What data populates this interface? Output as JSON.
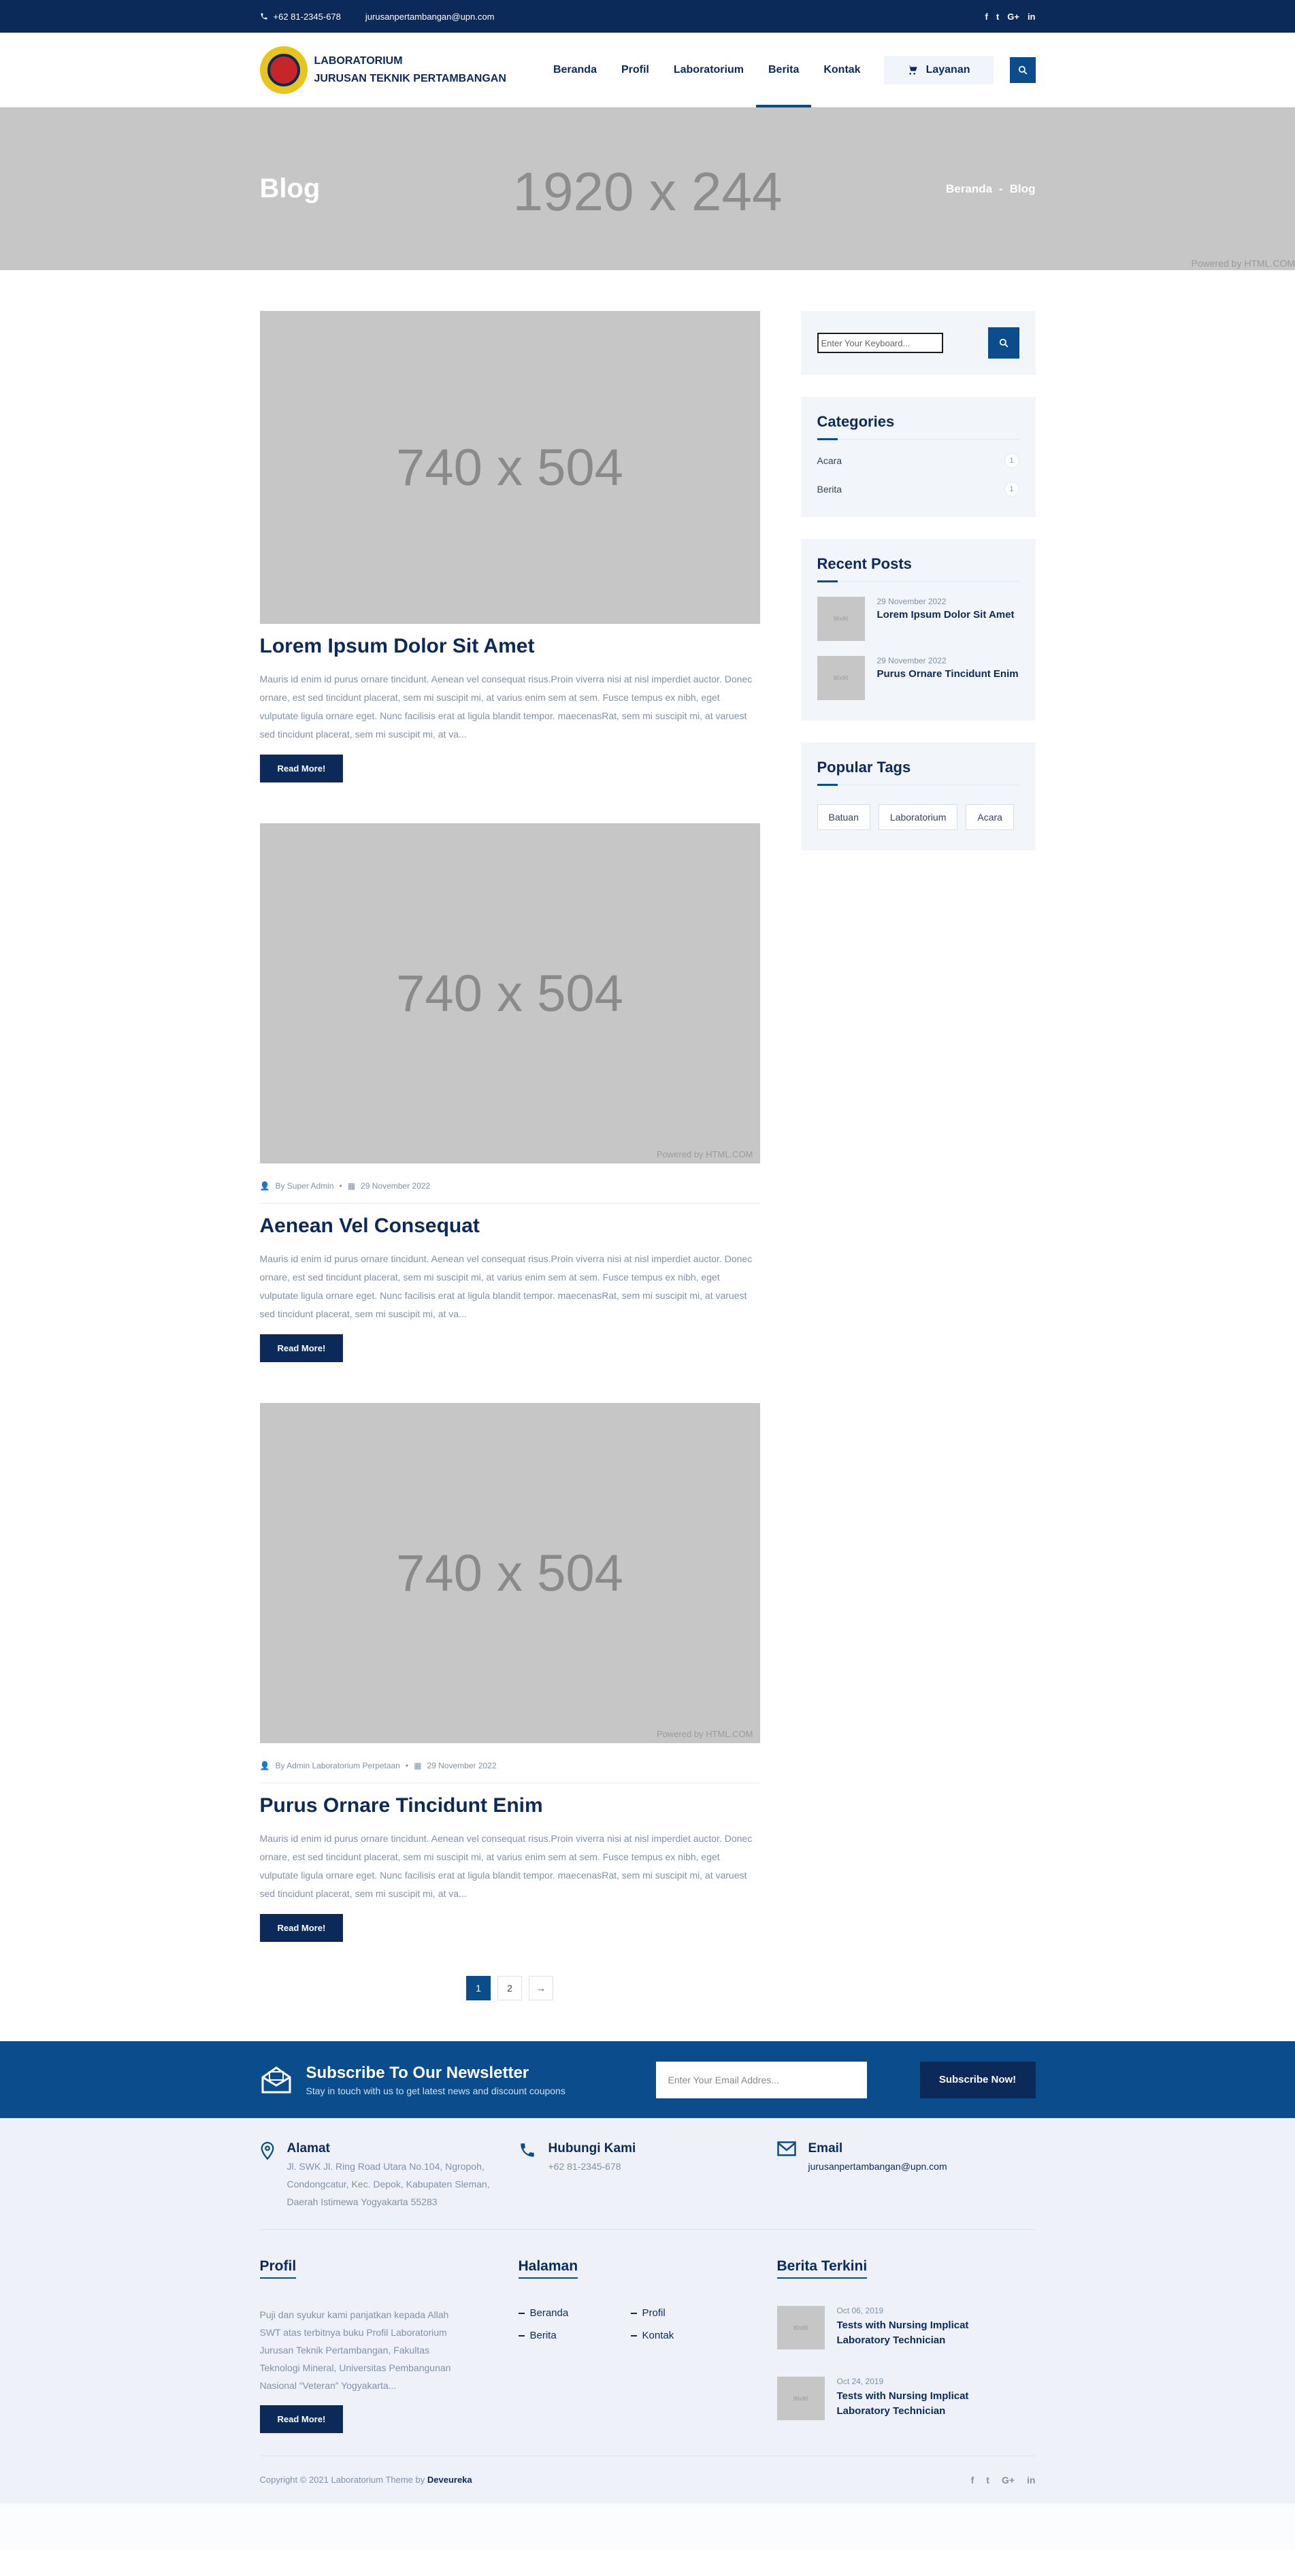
{
  "topbar": {
    "phone": "+62 81-2345-678",
    "email": "jurusanpertambangan@upn.com",
    "social": [
      "f",
      "t",
      "G+",
      "in"
    ]
  },
  "header": {
    "brand_line1": "LABORATORIUM",
    "brand_line2": "JURUSAN TEKNIK PERTAMBANGAN",
    "nav": [
      "Beranda",
      "Profil",
      "Laboratorium",
      "Berita",
      "Kontak"
    ],
    "layanan": "Layanan"
  },
  "hero": {
    "title": "Blog",
    "placeholder": "1920 x 244",
    "crumb_home": "Beranda",
    "crumb_sep": "-",
    "crumb_current": "Blog",
    "powered": "Powered by HTML.COM"
  },
  "posts": [
    {
      "image": "740 x 504",
      "powered": "",
      "author": "",
      "date": "",
      "title": "Lorem Ipsum Dolor Sit Amet",
      "excerpt": "Mauris id enim id purus ornare tincidunt. Aenean vel consequat risus.Proin viverra nisi at nisl imperdiet auctor. Donec ornare, est sed tincidunt placerat, sem mi suscipit mi, at varius enim sem at sem. Fusce tempus ex nibh, eget vulputate ligula ornare eget. Nunc facilisis erat at ligula blandit tempor. maecenasRat, sem mi suscipit mi, at varuest sed tincidunt placerat, sem mi suscipit mi, at va...",
      "button": "Read More!"
    },
    {
      "image": "740 x 504",
      "powered": "Powered by HTML.COM",
      "author": "By Super Admin",
      "date": "29 November 2022",
      "title": "Aenean Vel Consequat",
      "excerpt": "Mauris id enim id purus ornare tincidunt. Aenean vel consequat risus.Proin viverra nisi at nisl imperdiet auctor. Donec ornare, est sed tincidunt placerat, sem mi suscipit mi, at varius enim sem at sem. Fusce tempus ex nibh, eget vulputate ligula ornare eget. Nunc facilisis erat at ligula blandit tempor. maecenasRat, sem mi suscipit mi, at varuest sed tincidunt placerat, sem mi suscipit mi, at va...",
      "button": "Read More!"
    },
    {
      "image": "740 x 504",
      "powered": "Powered by HTML.COM",
      "author": "By Admin Laboratorium Perpetaan",
      "date": "29 November 2022",
      "title": "Purus Ornare Tincidunt Enim",
      "excerpt": "Mauris id enim id purus ornare tincidunt. Aenean vel consequat risus.Proin viverra nisi at nisl imperdiet auctor. Donec ornare, est sed tincidunt placerat, sem mi suscipit mi, at varius enim sem at sem. Fusce tempus ex nibh, eget vulputate ligula ornare eget. Nunc facilisis erat at ligula blandit tempor. maecenasRat, sem mi suscipit mi, at varuest sed tincidunt placerat, sem mi suscipit mi, at va...",
      "button": "Read More!"
    }
  ],
  "pagination": [
    "1",
    "2",
    "→"
  ],
  "sidebar": {
    "search_placeholder": "Enter Your Keyboard...",
    "categories_title": "Categories",
    "categories": [
      {
        "name": "Acara",
        "count": "1"
      },
      {
        "name": "Berita",
        "count": "1"
      }
    ],
    "recent_title": "Recent Posts",
    "recent": [
      {
        "date": "29 November 2022",
        "title": "Lorem Ipsum Dolor Sit Amet"
      },
      {
        "date": "29 November 2022",
        "title": "Purus Ornare Tincidunt Enim"
      }
    ],
    "tags_title": "Popular Tags",
    "tags": [
      "Batuan",
      "Laboratorium",
      "Acara"
    ]
  },
  "newsletter": {
    "title": "Subscribe To Our Newsletter",
    "subtitle": "Stay in touch with us to get latest news and discount coupons",
    "placeholder": "Enter Your Email Addres...",
    "button": "Subscribe Now!"
  },
  "footer": {
    "address_title": "Alamat",
    "address": "Jl. SWK Jl. Ring Road Utara No.104, Ngropoh, Condongcatur, Kec. Depok, Kabupaten Sleman, Daerah Istimewa Yogyakarta 55283",
    "phone_title": "Hubungi Kami",
    "phone": "+62 81-2345-678",
    "email_title": "Email",
    "email": "jurusanpertambangan@upn.com",
    "profil_title": "Profil",
    "profil_text": "Puji dan syukur kami panjatkan kepada Allah SWT atas terbitnya buku Profil Laboratorium Jurusan Teknik Pertambangan, Fakultas Teknologi Mineral, Universitas Pembangunan Nasional “Veteran” Yogyakarta...",
    "profil_button": "Read More!",
    "halaman_title": "Halaman",
    "halaman_links": [
      "Beranda",
      "Profil",
      "Berita",
      "Kontak"
    ],
    "berita_title": "Berita Terkini",
    "berita": [
      {
        "date": "Oct 06, 2019",
        "title": "Tests with Nursing Implicat Laboratory Technician"
      },
      {
        "date": "Oct 24, 2019",
        "title": "Tests with Nursing Implicat Laboratory Technician"
      }
    ],
    "copyright": "Copyright © 2021 Laboratorium Theme by",
    "author": "Deveureka",
    "social": [
      "f",
      "t",
      "G+",
      "in"
    ]
  }
}
